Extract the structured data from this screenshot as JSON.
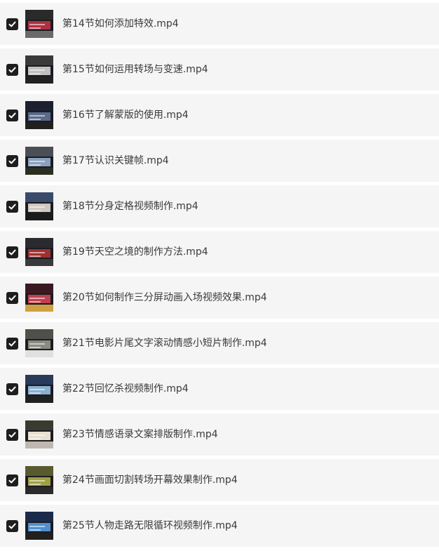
{
  "icons": {
    "checkbox": "checkbox-checked-icon",
    "thumbnail": "video-thumbnail"
  },
  "colors": {
    "row_background": "#f5f5f5",
    "checkbox": "#1e1e1e",
    "text": "#3a3a3a"
  },
  "files": [
    {
      "name": "第14节如何添加特效.mp4",
      "checked": true,
      "thumb_colors": [
        "#2a2a2a",
        "#b03040",
        "#6a6a6a"
      ]
    },
    {
      "name": "第15节如何运用转场与变速.mp4",
      "checked": true,
      "thumb_colors": [
        "#3a3a3a",
        "#c0c0c0",
        "#222222"
      ]
    },
    {
      "name": "第16节了解蒙版的使用.mp4",
      "checked": true,
      "thumb_colors": [
        "#1c2030",
        "#5a6a8a",
        "#202020"
      ]
    },
    {
      "name": "第17节认识关键帧.mp4",
      "checked": true,
      "thumb_colors": [
        "#4a4f55",
        "#8aa0c0",
        "#2a2f20"
      ]
    },
    {
      "name": "第18节分身定格视频制作.mp4",
      "checked": true,
      "thumb_colors": [
        "#3a4a6a",
        "#d0c8c0",
        "#1a1a1a"
      ]
    },
    {
      "name": "第19节天空之境的制作方法.mp4",
      "checked": true,
      "thumb_colors": [
        "#2a2a30",
        "#a03030",
        "#3a3a3a"
      ]
    },
    {
      "name": "第20节如何制作三分屏动画入场视频效果.mp4",
      "checked": true,
      "thumb_colors": [
        "#3a1a20",
        "#c04050",
        "#d0a040"
      ]
    },
    {
      "name": "第21节电影片尾文字滚动情感小短片制作.mp4",
      "checked": true,
      "thumb_colors": [
        "#50504a",
        "#8a8a80",
        "#e0e0e0"
      ]
    },
    {
      "name": "第22节回忆杀视频制作.mp4",
      "checked": true,
      "thumb_colors": [
        "#2a3a5a",
        "#8ab0d0",
        "#202020"
      ]
    },
    {
      "name": "第23节情感语录文案排版制作.mp4",
      "checked": true,
      "thumb_colors": [
        "#3a3a30",
        "#e8e0d0",
        "#c0b8b0"
      ]
    },
    {
      "name": "第24节画面切割转场开幕效果制作.mp4",
      "checked": true,
      "thumb_colors": [
        "#5a5a30",
        "#a0a040",
        "#2a2a2a"
      ]
    },
    {
      "name": "第25节人物走路无限循环视频制作.mp4",
      "checked": true,
      "thumb_colors": [
        "#1a2a4a",
        "#5090d0",
        "#202020"
      ]
    }
  ]
}
